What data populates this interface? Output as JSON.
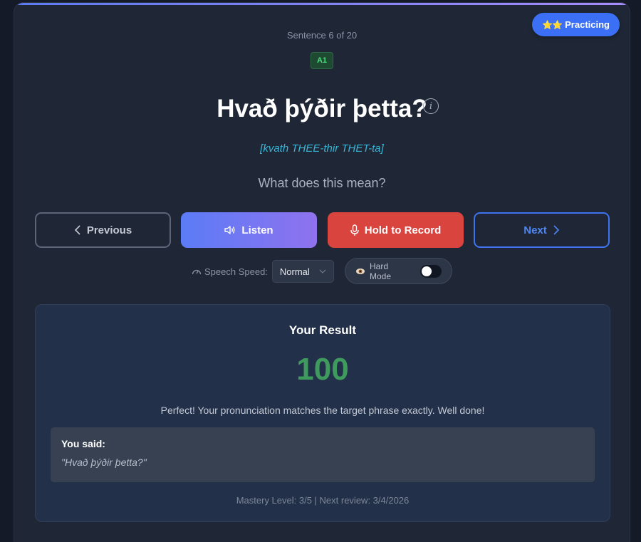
{
  "badge": {
    "label": "Practicing",
    "stars": "⭐⭐"
  },
  "progress": {
    "label": "Sentence 6 of 20",
    "current": 6,
    "total": 20
  },
  "level": "A1",
  "phrase": {
    "text": "Hvað þýðir þetta?",
    "pronunciation": "[kvath THEE-thir THET-ta]",
    "prompt": "What does this mean?"
  },
  "actions": {
    "previous": "Previous",
    "listen": "Listen",
    "record": "Hold to Record",
    "next": "Next"
  },
  "speech": {
    "label": "Speech Speed:",
    "value": "Normal"
  },
  "hard_mode": {
    "label": "Hard Mode",
    "enabled": false
  },
  "result": {
    "title": "Your Result",
    "score": "100",
    "feedback": "Perfect! Your pronunciation matches the target phrase exactly. Well done!",
    "you_said_label": "You said:",
    "you_said": "\"Hvað þýðir þetta?\"",
    "mastery": "Mastery Level: 3/5 | Next review: 3/4/2026"
  },
  "colors": {
    "accent": "#3b6ff5",
    "record": "#d9443f",
    "score": "#3e9a5d",
    "pronunciation": "#38b7d8"
  }
}
